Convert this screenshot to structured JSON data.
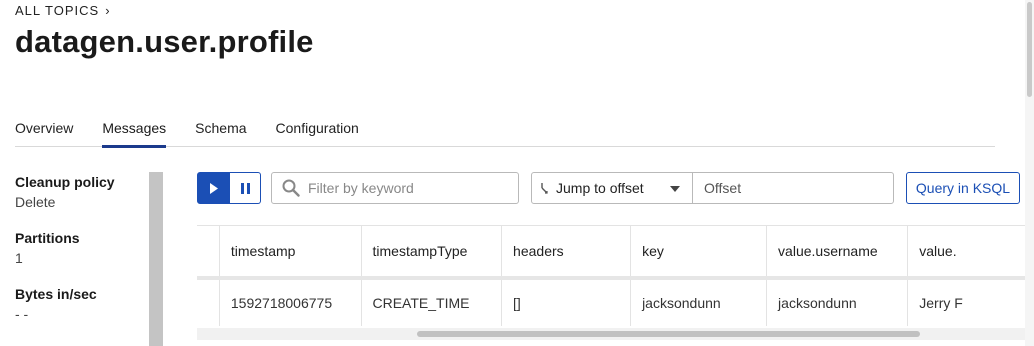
{
  "breadcrumb": {
    "label": "ALL TOPICS"
  },
  "page": {
    "title": "datagen.user.profile"
  },
  "tabs": [
    {
      "label": "Overview",
      "active": false
    },
    {
      "label": "Messages",
      "active": true
    },
    {
      "label": "Schema",
      "active": false
    },
    {
      "label": "Configuration",
      "active": false
    }
  ],
  "sidebar": {
    "cleanup_label": "Cleanup policy",
    "cleanup_value": "Delete",
    "partitions_label": "Partitions",
    "partitions_value": "1",
    "bytes_label": "Bytes in/sec",
    "bytes_value": "- -"
  },
  "toolbar": {
    "search_placeholder": "Filter by keyword",
    "jump_label": "Jump to offset",
    "offset_placeholder": "Offset",
    "ksql_label": "Query in KSQL"
  },
  "table": {
    "columns": [
      "timestamp",
      "timestampType",
      "headers",
      "key",
      "value.username",
      "value."
    ],
    "rows": [
      [
        "1592718006775",
        "CREATE_TIME",
        "[]",
        "jacksondunn",
        "jacksondunn",
        "Jerry F"
      ]
    ]
  },
  "colors": {
    "accent": "#1b4fb5",
    "tab_underline": "#1b3a8c"
  },
  "icons": [
    "chevron-right-icon",
    "play-icon",
    "pause-icon",
    "search-icon",
    "offset-icon",
    "caret-down-icon"
  ]
}
